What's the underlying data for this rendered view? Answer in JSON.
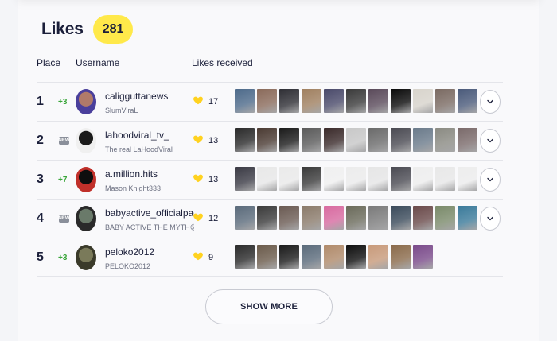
{
  "section": {
    "title": "Likes",
    "count": "281"
  },
  "columns": {
    "place": "Place",
    "username": "Username",
    "likes_received": "Likes received"
  },
  "rows": [
    {
      "place": "1",
      "change": "+3",
      "change_type": "up",
      "username": "caligguttanews",
      "display_name": "SlumViraL",
      "likes": "17",
      "avatar_colors": [
        "#b07a6a",
        "#4a3f9c"
      ],
      "thumbs": [
        "#4d6a8a",
        "#8a6a5a",
        "#2e2e34",
        "#a08060",
        "#4a4a6a",
        "#3a3a3a",
        "#5a4a5a",
        "#0a0a0a",
        "#d8d4cc",
        "#7a6a62",
        "#4a5a7a"
      ]
    },
    {
      "place": "2",
      "change": "NEW",
      "change_type": "new",
      "username": "lahoodviral_tv_",
      "display_name": "The real LaHoodViral",
      "likes": "13",
      "avatar_colors": [
        "#1b1b1b",
        "#f0f0f0"
      ],
      "thumbs": [
        "#2a2a2a",
        "#4a3a32",
        "#1a1a1a",
        "#5a5a5a",
        "#3a2a2a",
        "#c8c8c8",
        "#6a6a6a",
        "#4a4a52",
        "#6a7a8a",
        "#8a8a82",
        "#7a6a6a"
      ]
    },
    {
      "place": "3",
      "change": "+7",
      "change_type": "up",
      "username": "a.million.hits",
      "display_name": "Mason Knight333",
      "likes": "13",
      "avatar_colors": [
        "#0e0e0e",
        "#c0302a"
      ],
      "thumbs": [
        "#3a3a44",
        "#e8e8e8",
        "#eaeaea",
        "#3a3a3a",
        "#f0f0f0",
        "#ececec",
        "#e6e6e6",
        "#4a4a52",
        "#eeeeee",
        "#e8e8e8",
        "#ededed"
      ]
    },
    {
      "place": "4",
      "change": "NEW",
      "change_type": "new",
      "username": "babyactive_officialpage",
      "display_name": "BABY ACTIVE THE MYTH😡 H",
      "likes": "12",
      "avatar_colors": [
        "#6a7a6a",
        "#2a2a2a"
      ],
      "thumbs": [
        "#5a6a7a",
        "#3a3a3a",
        "#6a5a52",
        "#8a7a6a",
        "#d86aa0",
        "#6a6a5a",
        "#7a7a7a",
        "#3a4a5a",
        "#6a4a4a",
        "#7a8a6a",
        "#3a7a9a"
      ]
    },
    {
      "place": "5",
      "change": "+3",
      "change_type": "up",
      "username": "peloko2012",
      "display_name": "PELOKO2012",
      "likes": "9",
      "avatar_colors": [
        "#7a7a5a",
        "#3a3a2a"
      ],
      "thumbs": [
        "#2a2a2a",
        "#6a5a4a",
        "#1a1a1a",
        "#5a6a7a",
        "#b08a6a",
        "#0e0e0e",
        "#c89a7a",
        "#8a6a4a",
        "#7a4a8a"
      ]
    }
  ],
  "show_more_label": "SHOW MORE",
  "colors": {
    "badge": "#ffe94a",
    "heart": "#ffd21f",
    "up": "#3aa63a",
    "text": "#1b1f3a"
  },
  "icons": {
    "heart": "heart-icon",
    "expand": "chevron-down-icon"
  }
}
